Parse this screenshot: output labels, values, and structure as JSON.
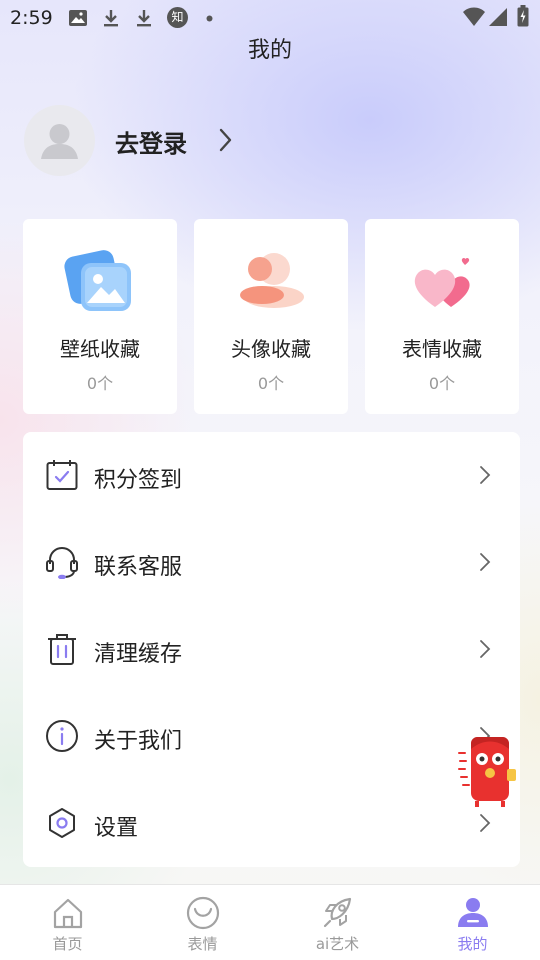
{
  "status_bar": {
    "time": "2:59",
    "icons": [
      "image-icon",
      "download-icon",
      "download-icon",
      "zhihu-icon",
      "dot-icon",
      "wifi-icon",
      "signal-icon",
      "battery-icon"
    ],
    "zhihu_glyph": "知"
  },
  "page": {
    "title": "我的"
  },
  "login": {
    "label": "去登录"
  },
  "collections": [
    {
      "label": "壁纸收藏",
      "count": "0个"
    },
    {
      "label": "头像收藏",
      "count": "0个"
    },
    {
      "label": "表情收藏",
      "count": "0个"
    }
  ],
  "menu": [
    {
      "label": "积分签到",
      "icon": "calendar-check-icon"
    },
    {
      "label": "联系客服",
      "icon": "headset-icon"
    },
    {
      "label": "清理缓存",
      "icon": "trash-icon"
    },
    {
      "label": "关于我们",
      "icon": "info-icon"
    },
    {
      "label": "设置",
      "icon": "settings-hexagon-icon"
    }
  ],
  "tabbar": {
    "tabs": [
      {
        "label": "首页",
        "icon": "home-icon"
      },
      {
        "label": "表情",
        "icon": "smile-icon"
      },
      {
        "label": "ai艺术",
        "icon": "rocket-icon"
      },
      {
        "label": "我的",
        "icon": "user-icon"
      }
    ],
    "active_index": 3
  },
  "colors": {
    "accent": "#8a7cf0",
    "inactive_tab": "#9a9a9a",
    "text": "#222222",
    "muted": "#999999"
  }
}
